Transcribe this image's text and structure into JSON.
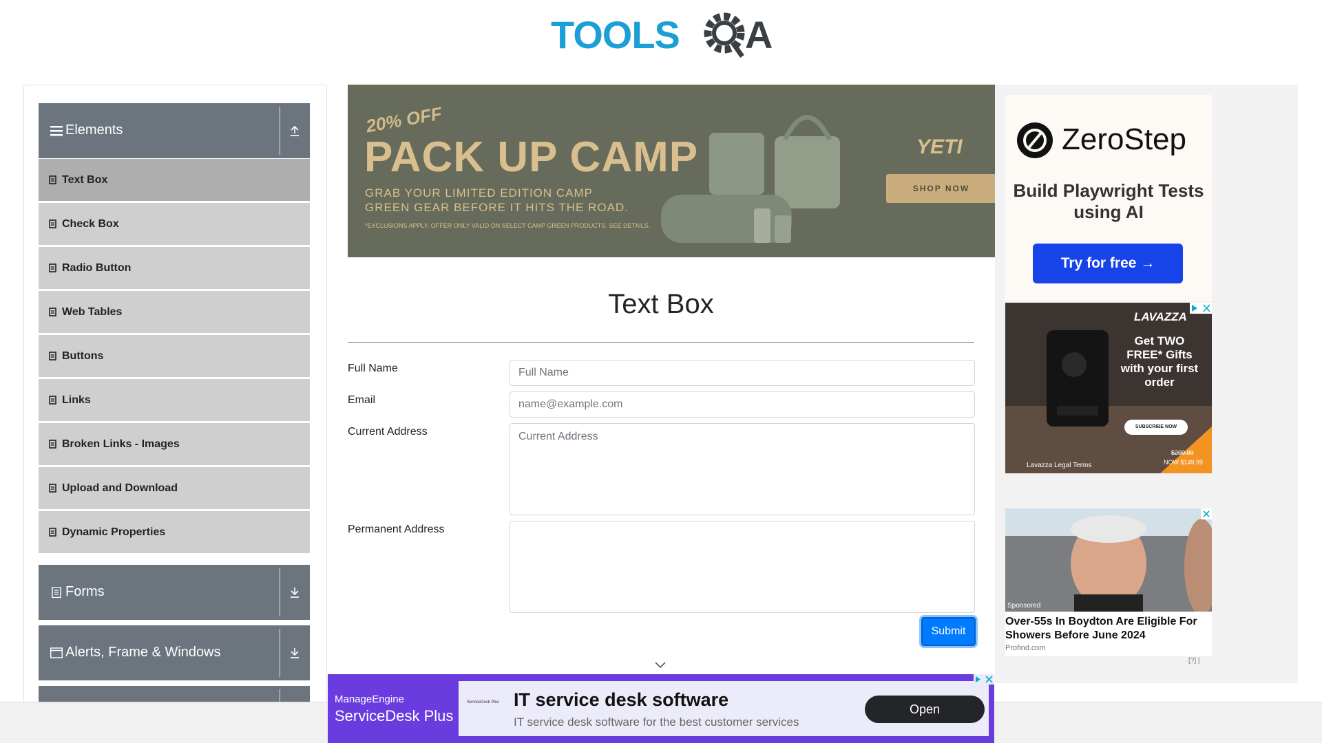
{
  "header": {
    "logo_text_left": "TOOLS",
    "logo_text_right": "A"
  },
  "sidebar": {
    "groups": [
      {
        "title": "Elements",
        "state": "expanded",
        "icon": "hamburger-icon"
      },
      {
        "title": "Forms",
        "state": "collapsed",
        "icon": "document-icon"
      },
      {
        "title": "Alerts, Frame & Windows",
        "state": "collapsed",
        "icon": "window-icon"
      }
    ],
    "items": [
      {
        "label": "Text Box",
        "active": true
      },
      {
        "label": "Check Box",
        "active": false
      },
      {
        "label": "Radio Button",
        "active": false
      },
      {
        "label": "Web Tables",
        "active": false
      },
      {
        "label": "Buttons",
        "active": false
      },
      {
        "label": "Links",
        "active": false
      },
      {
        "label": "Broken Links - Images",
        "active": false
      },
      {
        "label": "Upload and Download",
        "active": false
      },
      {
        "label": "Dynamic Properties",
        "active": false
      }
    ]
  },
  "top_ad": {
    "discount": "20% OFF",
    "headline": "PACK UP CAMP",
    "line1": "GRAB YOUR LIMITED EDITION CAMP",
    "line2": "GREEN GEAR BEFORE IT HITS THE ROAD.",
    "fine_print": "*EXCLUSIONS APPLY. OFFER ONLY VALID ON SELECT CAMP GREEN PRODUCTS. SEE DETAILS.",
    "brand": "YETI",
    "cta": "SHOP NOW"
  },
  "form": {
    "title": "Text Box",
    "full_name": {
      "label": "Full Name",
      "placeholder": "Full Name",
      "value": ""
    },
    "email": {
      "label": "Email",
      "placeholder": "name@example.com",
      "value": ""
    },
    "current_address": {
      "label": "Current Address",
      "placeholder": "Current Address",
      "value": ""
    },
    "permanent_address": {
      "label": "Permanent Address",
      "placeholder": "",
      "value": ""
    },
    "submit_label": "Submit"
  },
  "right_ads": {
    "zerostep": {
      "brand": "ZeroStep",
      "tagline": "Build Playwright Tests using AI",
      "cta": "Try for free →"
    },
    "lavazza": {
      "brand": "LAVAZZA",
      "headline": "Get TWO FREE* Gifts with your first order",
      "cta": "SUBSCRIBE NOW",
      "old_price": "$200.00",
      "new_price": "NOW $149.99",
      "legal": "Lavazza Legal Terms"
    },
    "sponsored": {
      "tag": "Sponsored",
      "title": "Over-55s In Boydton Are Eligible For Showers Before June 2024",
      "source": "Profind.com",
      "info": "[?] |"
    }
  },
  "bottom_ad": {
    "brand": "ManageEngine",
    "product": "ServiceDesk Plus",
    "mini_brand": "ServiceDesk Plus",
    "title": "IT service desk software",
    "subtitle": "IT service desk software for the best customer services",
    "cta": "Open"
  },
  "colors": {
    "sidebar_header": "#6c757d",
    "sidebar_item": "#cfcfcf",
    "sidebar_item_active": "#aeaeae",
    "primary": "#007bff",
    "logo_blue": "#1a9fd6",
    "logo_dark": "#3a3f44"
  }
}
